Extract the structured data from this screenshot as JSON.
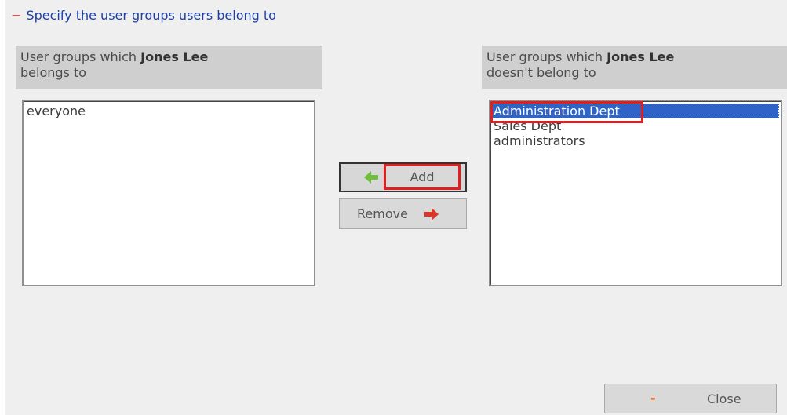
{
  "section": {
    "toggle": "−",
    "title": "Specify the user groups users belong to"
  },
  "user_name": "Jones Lee",
  "left_panel": {
    "header_prefix": "User groups which",
    "header_suffix": "belongs to",
    "items": [
      "everyone"
    ]
  },
  "right_panel": {
    "header_prefix": "User groups which",
    "header_suffix": "doesn't belong to",
    "items": [
      "Administration Dept",
      "Sales Dept",
      "administrators"
    ],
    "selected_index": 0
  },
  "buttons": {
    "add_label": "Add",
    "remove_label": "Remove",
    "close_label": "Close",
    "close_icon": "-"
  },
  "icons": {
    "add_arrow": "green-left-arrow-icon",
    "remove_arrow": "red-right-arrow-icon"
  },
  "colors": {
    "title_blue": "#1a3fa8",
    "selection_blue": "#2f63c8",
    "highlight_red": "#e02020",
    "add_arrow_green": "#6fbf3a",
    "remove_arrow_red": "#d8372a"
  }
}
